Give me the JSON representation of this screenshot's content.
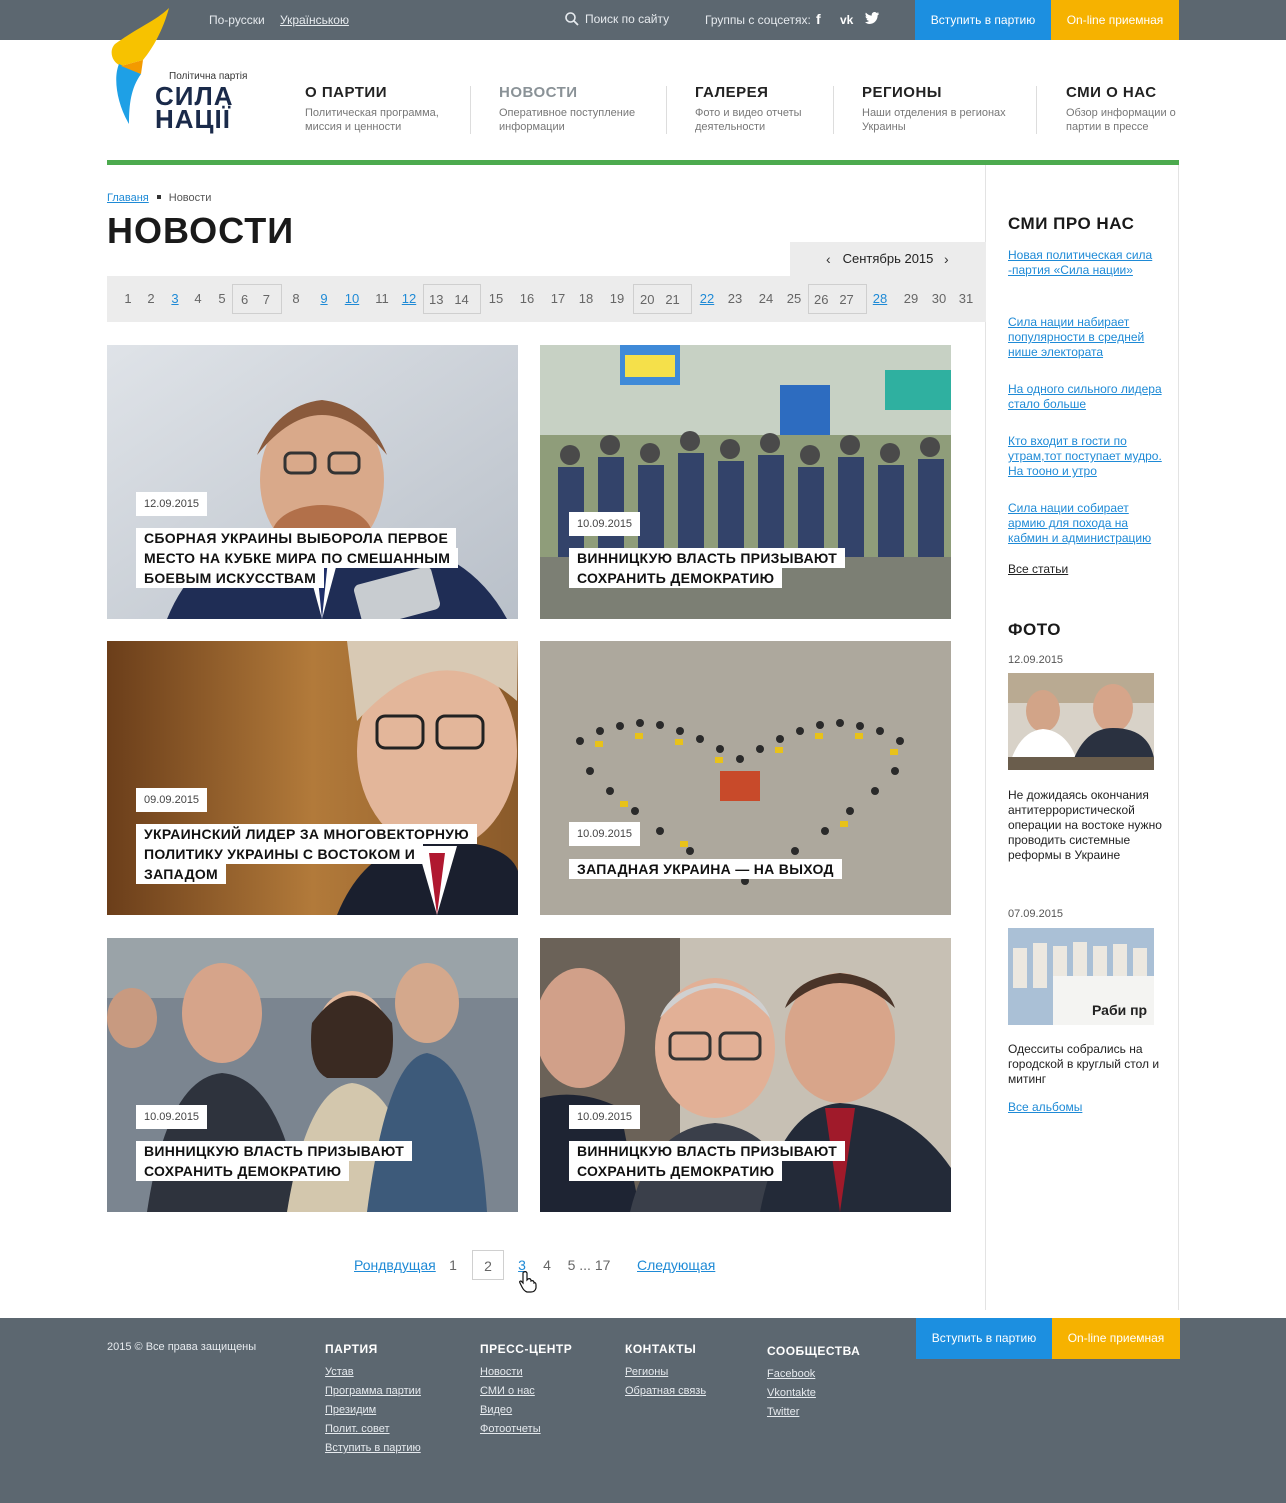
{
  "topbar": {
    "lang_ru": "По-русски",
    "lang_ua": "Українською",
    "search": "Поиск по сайту",
    "social_label": "Группы с соцсетях:",
    "join": "Вступить в партию",
    "online": "On-line приемная"
  },
  "logo": {
    "subtitle": "Політична партія",
    "line1": "СИЛА",
    "line2": "НАЦІЇ"
  },
  "nav": [
    {
      "title": "О ПАРТИИ",
      "desc1": "Политическая программа,",
      "desc2": "миссия и ценности"
    },
    {
      "title": "НОВОСТИ",
      "desc1": "Оперативное поступление",
      "desc2": "информации"
    },
    {
      "title": "ГАЛЕРЕЯ",
      "desc1": "Фото и видео отчеты",
      "desc2": "деятельности"
    },
    {
      "title": "РЕГИОНЫ",
      "desc1": "Наши отделения в регионах",
      "desc2": "Украины"
    },
    {
      "title": "СМИ О НАС",
      "desc1": "Обзор информации о",
      "desc2": "партии в прессе"
    }
  ],
  "breadcrumbs": {
    "home": "Главаня",
    "current": "Новости"
  },
  "page_title": "НОВОСТИ",
  "calendar": {
    "month": "Сентябрь 2015",
    "days": [
      "1",
      "2",
      "3",
      "4",
      "5",
      "6",
      "7",
      "8",
      "9",
      "10",
      "11",
      "12",
      "13",
      "14",
      "15",
      "16",
      "17",
      "18",
      "19",
      "20",
      "21",
      "22",
      "23",
      "24",
      "25",
      "26",
      "27",
      "28",
      "29",
      "30",
      "31"
    ]
  },
  "news": [
    {
      "date": "12.09.2015",
      "title": "СБОРНАЯ УКРАИНЫ ВЫБОРОЛА ПЕРВОЕ МЕСТО НА КУБКЕ МИРА ПО СМЕШАННЫМ БОЕВЫМ ИСКУССТВАМ"
    },
    {
      "date": "10.09.2015",
      "title": "ВИННИЦКУЮ ВЛАСТЬ ПРИЗЫВАЮТ СОХРАНИТЬ ДЕМОКРАТИЮ"
    },
    {
      "date": "09.09.2015",
      "title": "УКРАИНСКИЙ ЛИДЕР ЗА МНОГОВЕКТОРНУЮ ПОЛИТИКУ УКРАИНЫ С ВОСТОКОМ И ЗАПАДОМ"
    },
    {
      "date": "10.09.2015",
      "title": "ЗАПАДНАЯ УКРАИНА — НА ВЫХОД"
    },
    {
      "date": "10.09.2015",
      "title": "ВИННИЦКУЮ ВЛАСТЬ ПРИЗЫВАЮТ СОХРАНИТЬ ДЕМОКРАТИЮ"
    },
    {
      "date": "10.09.2015",
      "title": "ВИННИЦКУЮ ВЛАСТЬ ПРИЗЫВАЮТ СОХРАНИТЬ ДЕМОКРАТИЮ"
    }
  ],
  "pagination": {
    "prev": "Рондвдущая",
    "p1": "1",
    "p2": "2",
    "p3": "3",
    "p4": "4",
    "p5": "5 ... 17",
    "next": "Следующая"
  },
  "sidebar": {
    "smi_title": "СМИ ПРО НАС",
    "smi_links": [
      "Новая политическая сила -партия «Сила нации»",
      "Сила нации набирает популярности в средней нише электората",
      "На одного сильного лидера стало больше",
      "Кто входит в гости по утрам,тот поступает мудро. На тооно и утро",
      "Сила нации собирает армию для похода на кабмин и администрацию"
    ],
    "all_articles": "Все статьи",
    "photo_title": "ФОТО",
    "photos": [
      {
        "date": "12.09.2015",
        "text": "Не дожидаясь окончания антитеррористической операции на востоке нужно проводить системные реформы в Украине"
      },
      {
        "date": "07.09.2015",
        "text": "Одесситы собрались на городской в круглый стол и митинг"
      }
    ],
    "banner_text": "Раби пр",
    "all_albums": "Все альбомы"
  },
  "footer": {
    "copyright": "2015 © Все права защищены",
    "cols": [
      {
        "title": "ПАРТИЯ",
        "links": [
          "Устав",
          "Программа партии",
          "Президим",
          "Полит. совет",
          "Вступить в партию"
        ]
      },
      {
        "title": "ПРЕСС-ЦЕНТР",
        "links": [
          "Новости",
          "СМИ о нас",
          "Видео",
          "Фотоотчеты"
        ]
      },
      {
        "title": "КОНТАКТЫ",
        "links": [
          "Регионы",
          "Обратная связь"
        ]
      },
      {
        "title": "СООБЩЕСТВА",
        "links": [
          "Facebook",
          "Vkontakte",
          "Twitter"
        ]
      }
    ],
    "join": "Вступить в партию",
    "online": "On-line приемная"
  },
  "colors": {
    "topbar": "#5c6770",
    "join": "#1c8fe0",
    "online": "#f6b200",
    "green_line": "#4caa4e",
    "link": "#1e8ad6"
  }
}
